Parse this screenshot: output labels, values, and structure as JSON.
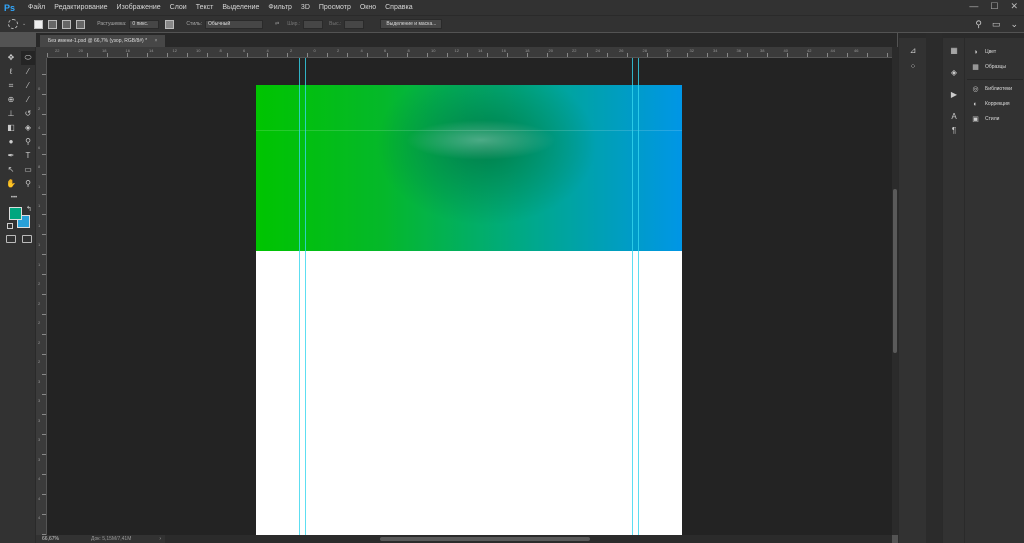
{
  "app": {
    "logo": "Ps"
  },
  "menu": [
    "Файл",
    "Редактирование",
    "Изображение",
    "Слои",
    "Текст",
    "Выделение",
    "Фильтр",
    "3D",
    "Просмотр",
    "Окно",
    "Справка"
  ],
  "window_controls": {
    "minimize": "—",
    "maximize": "☐",
    "close": "✕"
  },
  "options": {
    "feather_label": "Растушевка:",
    "feather_value": "0 пикс.",
    "style_label": "Стиль:",
    "style_value": "Обычный",
    "width_label": "Шир.:",
    "height_label": "Выс.:",
    "refine_button": "Выделение и маска..."
  },
  "tab": {
    "title": "Без имени-1.psd @ 66,7% (узор, RGB/8#) *",
    "close": "×"
  },
  "ruler_h_labels": [
    "22",
    "20",
    "18",
    "16",
    "14",
    "12",
    "10",
    "8",
    "6",
    "4",
    "2",
    "0",
    "2",
    "4",
    "6",
    "8",
    "10",
    "12",
    "14",
    "16",
    "18",
    "20",
    "22",
    "24",
    "26",
    "28",
    "30",
    "32",
    "34",
    "36",
    "38",
    "40",
    "42",
    "44",
    "46"
  ],
  "ruler_v_labels": [
    "0",
    "2",
    "4",
    "6",
    "8",
    "1",
    "1",
    "1",
    "1",
    "1",
    "2",
    "2",
    "2",
    "2",
    "2",
    "3",
    "3",
    "3",
    "3",
    "3",
    "4",
    "4",
    "4",
    "4"
  ],
  "toolbar": {
    "tools": [
      {
        "name": "move-tool",
        "glyph": "✥"
      },
      {
        "name": "marquee-tool",
        "glyph": "⬭"
      },
      {
        "name": "lasso-tool",
        "glyph": "ℓ"
      },
      {
        "name": "magic-wand-tool",
        "glyph": "⁄"
      },
      {
        "name": "crop-tool",
        "glyph": "⌗"
      },
      {
        "name": "eyedropper-tool",
        "glyph": "⁄"
      },
      {
        "name": "healing-tool",
        "glyph": "⊕"
      },
      {
        "name": "brush-tool",
        "glyph": "⁄"
      },
      {
        "name": "stamp-tool",
        "glyph": "⊥"
      },
      {
        "name": "history-brush-tool",
        "glyph": "↺"
      },
      {
        "name": "eraser-tool",
        "glyph": "◧"
      },
      {
        "name": "bucket-tool",
        "glyph": "◈"
      },
      {
        "name": "blur-tool",
        "glyph": "●"
      },
      {
        "name": "dodge-tool",
        "glyph": "⚲"
      },
      {
        "name": "pen-tool",
        "glyph": "✒"
      },
      {
        "name": "type-tool",
        "glyph": "T"
      },
      {
        "name": "path-select-tool",
        "glyph": "↖"
      },
      {
        "name": "shape-tool",
        "glyph": "▭"
      },
      {
        "name": "hand-tool",
        "glyph": "✋"
      },
      {
        "name": "zoom-tool",
        "glyph": "⚲"
      }
    ],
    "more": "•••",
    "foreground_color": "#00a67f",
    "background_color": "#28a0d8"
  },
  "document": {
    "banner_colors": [
      "#00c400",
      "#00a88c",
      "#0096e6"
    ],
    "guide_color": "#34d6ee"
  },
  "status": {
    "zoom": "66,67%",
    "doc_info": "Док: 5,15M/7,41M",
    "arrow": "›"
  },
  "panels": {
    "dock1": [
      {
        "name": "history-icon",
        "glyph": "⊿"
      },
      {
        "name": "brush-settings-icon",
        "glyph": "⁘"
      }
    ],
    "dock2": [
      {
        "name": "properties-icon",
        "glyph": "▦"
      },
      {
        "name": "layers-icon",
        "glyph": "◈"
      },
      {
        "name": "actions-icon",
        "glyph": "▶"
      },
      {
        "name": "character-icon",
        "glyph": "A"
      },
      {
        "name": "paragraph-icon",
        "glyph": "¶"
      }
    ],
    "list": [
      {
        "label": "Цвет",
        "icon": "color-icon",
        "glyph": "◑"
      },
      {
        "label": "Образцы",
        "icon": "swatches-icon",
        "glyph": "▦"
      },
      {
        "label": "Библиотеки",
        "icon": "libraries-icon",
        "glyph": "◎"
      },
      {
        "label": "Коррекция",
        "icon": "adjustments-icon",
        "glyph": "◐"
      },
      {
        "label": "Стили",
        "icon": "styles-icon",
        "glyph": "▣"
      }
    ]
  }
}
